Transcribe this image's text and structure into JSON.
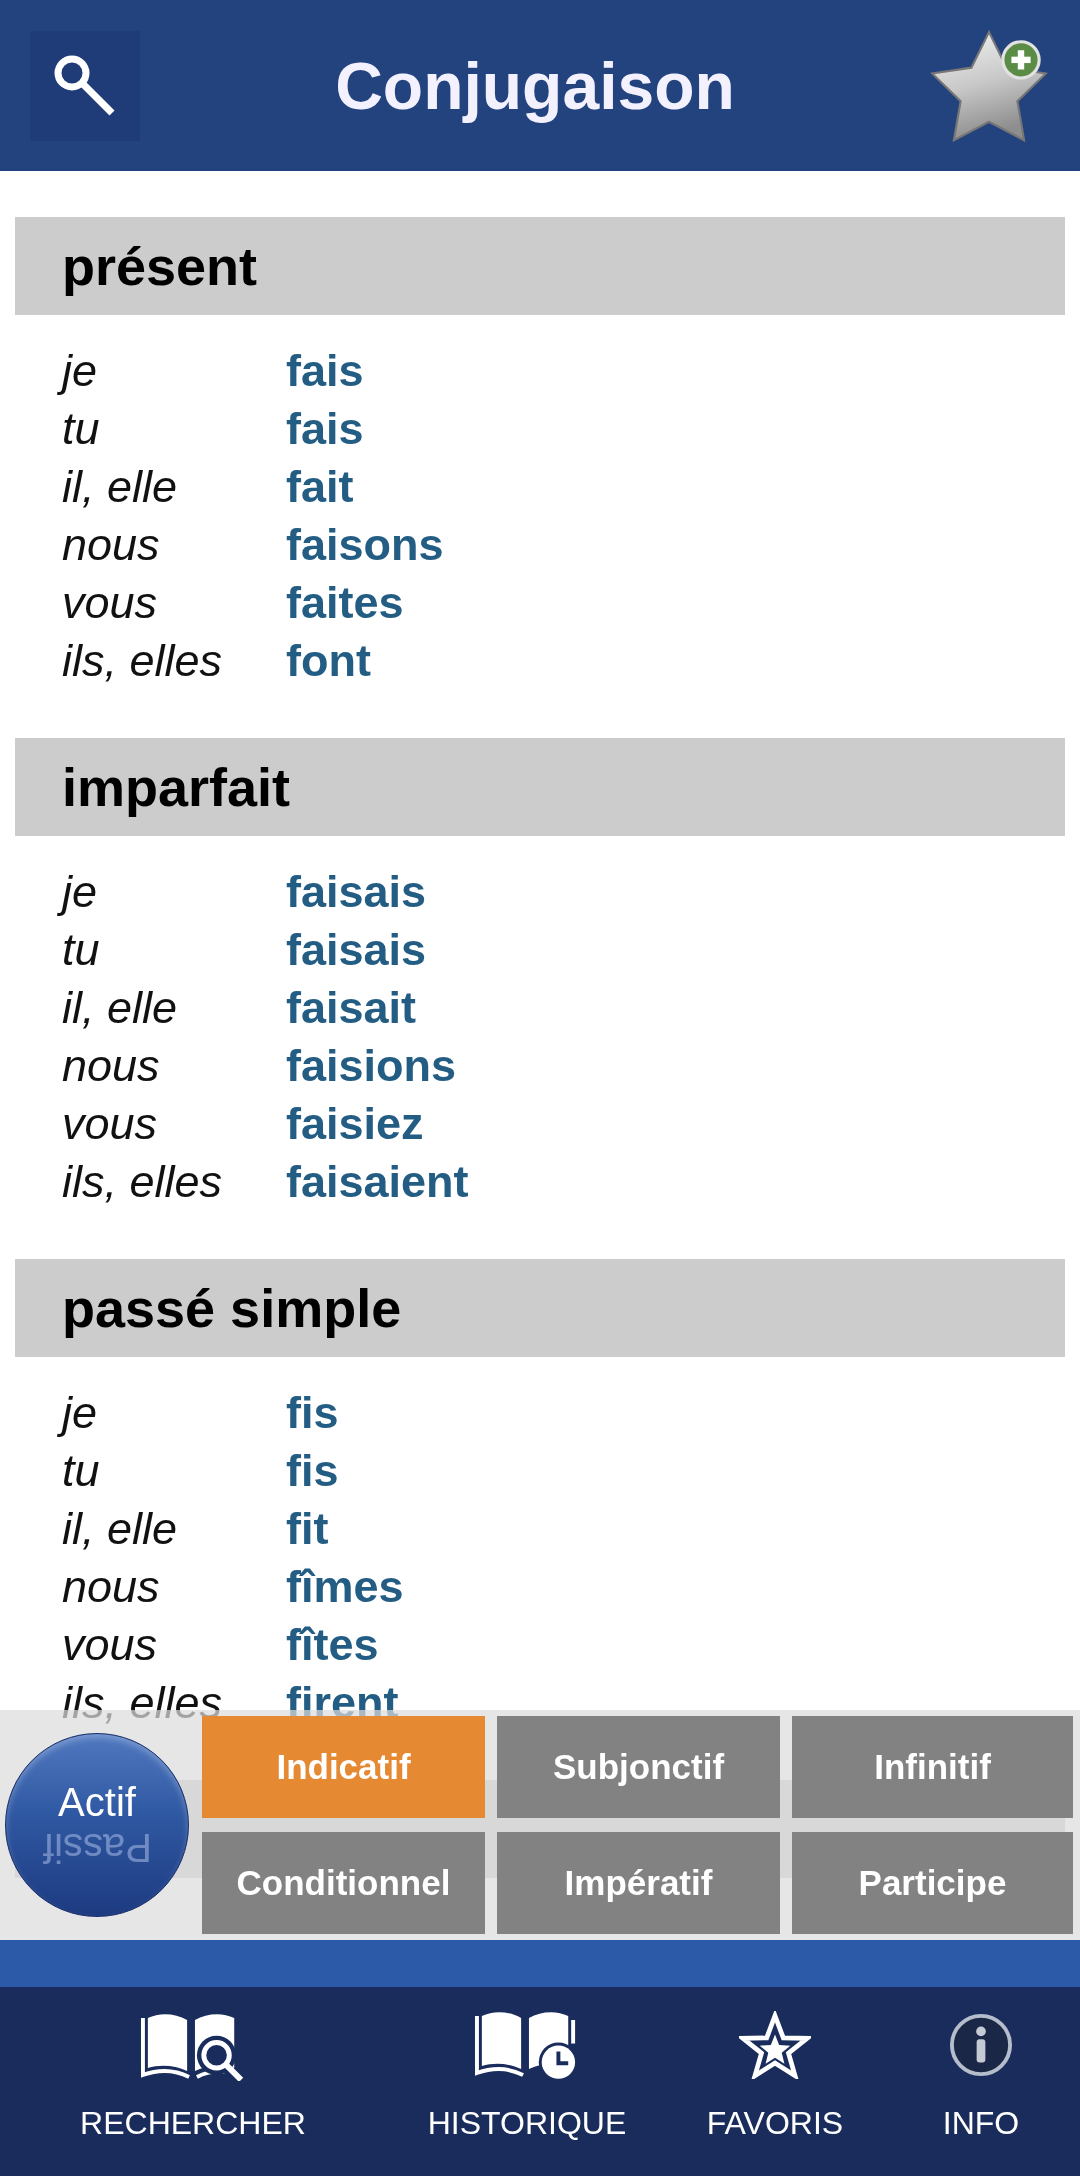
{
  "header": {
    "title": "Conjugaison"
  },
  "sections": [
    {
      "heading": "présent",
      "rows": [
        {
          "pronoun": "je",
          "verb": "fais"
        },
        {
          "pronoun": "tu",
          "verb": "fais"
        },
        {
          "pronoun": "il, elle",
          "verb": "fait"
        },
        {
          "pronoun": "nous",
          "verb": "faisons"
        },
        {
          "pronoun": "vous",
          "verb": "faites"
        },
        {
          "pronoun": "ils, elles",
          "verb": "font"
        }
      ]
    },
    {
      "heading": "imparfait",
      "rows": [
        {
          "pronoun": "je",
          "verb": "faisais"
        },
        {
          "pronoun": "tu",
          "verb": "faisais"
        },
        {
          "pronoun": "il, elle",
          "verb": "faisait"
        },
        {
          "pronoun": "nous",
          "verb": "faisions"
        },
        {
          "pronoun": "vous",
          "verb": "faisiez"
        },
        {
          "pronoun": "ils, elles",
          "verb": "faisaient"
        }
      ]
    },
    {
      "heading": "passé simple",
      "rows": [
        {
          "pronoun": "je",
          "verb": "fis"
        },
        {
          "pronoun": "tu",
          "verb": "fis"
        },
        {
          "pronoun": "il, elle",
          "verb": "fit"
        },
        {
          "pronoun": "nous",
          "verb": "fîmes"
        },
        {
          "pronoun": "vous",
          "verb": "fîtes"
        },
        {
          "pronoun": "ils, elles",
          "verb": "firent"
        }
      ]
    }
  ],
  "voice_toggle": {
    "options": [
      {
        "label": "Actif",
        "selected": true
      },
      {
        "label": "Passif",
        "selected": false
      }
    ]
  },
  "moods": [
    {
      "label": "Indicatif",
      "selected": true
    },
    {
      "label": "Subjonctif",
      "selected": false
    },
    {
      "label": "Infinitif",
      "selected": false
    },
    {
      "label": "Conditionnel",
      "selected": false
    },
    {
      "label": "Impératif",
      "selected": false
    },
    {
      "label": "Participe",
      "selected": false
    }
  ],
  "nav": [
    {
      "label": "RECHERCHER"
    },
    {
      "label": "HISTORIQUE"
    },
    {
      "label": "FAVORIS"
    },
    {
      "label": "INFO"
    }
  ]
}
